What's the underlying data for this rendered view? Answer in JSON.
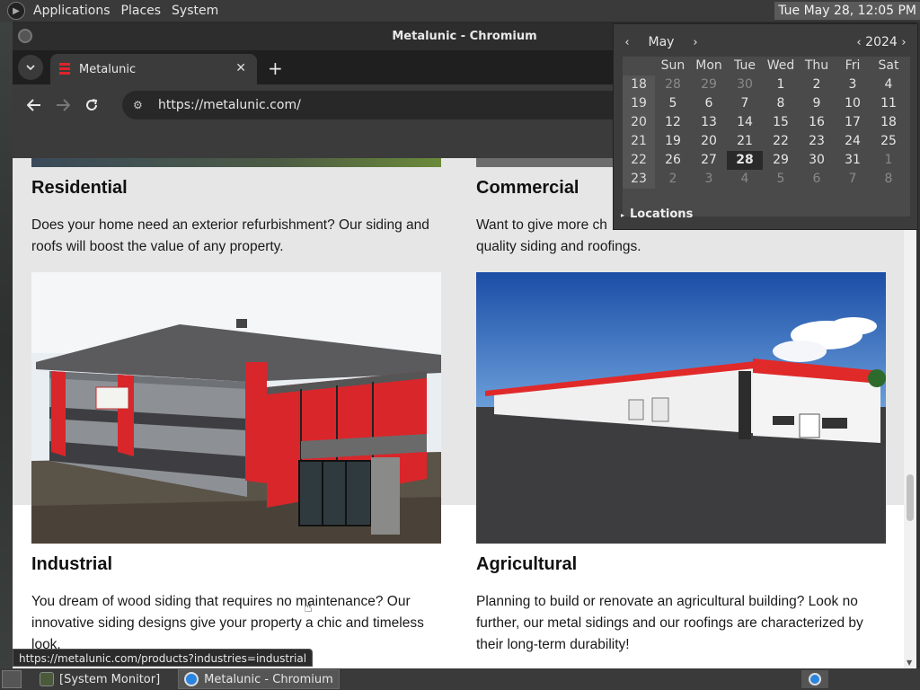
{
  "panel": {
    "menus": [
      "Applications",
      "Places",
      "System"
    ],
    "clock": "Tue May 28, 12:05 PM"
  },
  "window": {
    "title": "Metalunic - Chromium",
    "tab": {
      "title": "Metalunic"
    },
    "url": "https://metalunic.com/"
  },
  "page": {
    "cards": [
      {
        "heading": "Residential",
        "text": "Does your home need an exterior refurbishment? Our siding and roofs will boost the value of any property."
      },
      {
        "heading": "Commercial",
        "text": "Want to give more ch... quality siding and roofings."
      },
      {
        "heading": "Industrial",
        "text": "You dream of wood siding that requires no maintenance? Our innovative siding designs give your property a chic and timeless look."
      },
      {
        "heading": "Agricultural",
        "text": "Planning to build or renovate an agricultural building? Look no further, our metal sidings and our roofings are characterized by their long-term durability!"
      }
    ],
    "commercial_visible_line1": "Want to give more ch",
    "commercial_visible_line2": "quality siding and roofings."
  },
  "status_url": "https://metalunic.com/products?industries=industrial",
  "calendar": {
    "month": "May",
    "year": "2024",
    "weekdays": [
      "Sun",
      "Mon",
      "Tue",
      "Wed",
      "Thu",
      "Fri",
      "Sat"
    ],
    "weeks": [
      {
        "num": "18",
        "days": [
          "28",
          "29",
          "30",
          "1",
          "2",
          "3",
          "4"
        ],
        "other": [
          true,
          true,
          true,
          false,
          false,
          false,
          false
        ]
      },
      {
        "num": "19",
        "days": [
          "5",
          "6",
          "7",
          "8",
          "9",
          "10",
          "11"
        ],
        "other": [
          false,
          false,
          false,
          false,
          false,
          false,
          false
        ]
      },
      {
        "num": "20",
        "days": [
          "12",
          "13",
          "14",
          "15",
          "16",
          "17",
          "18"
        ],
        "other": [
          false,
          false,
          false,
          false,
          false,
          false,
          false
        ]
      },
      {
        "num": "21",
        "days": [
          "19",
          "20",
          "21",
          "22",
          "23",
          "24",
          "25"
        ],
        "other": [
          false,
          false,
          false,
          false,
          false,
          false,
          false
        ]
      },
      {
        "num": "22",
        "days": [
          "26",
          "27",
          "28",
          "29",
          "30",
          "31",
          "1"
        ],
        "other": [
          false,
          false,
          false,
          false,
          false,
          false,
          true
        ]
      },
      {
        "num": "23",
        "days": [
          "2",
          "3",
          "4",
          "5",
          "6",
          "7",
          "8"
        ],
        "other": [
          true,
          true,
          true,
          true,
          true,
          true,
          true
        ]
      }
    ],
    "today": "28",
    "locations_label": "Locations"
  },
  "taskbar": {
    "tasks": [
      "[System Monitor]",
      "Metalunic - Chromium"
    ]
  },
  "colors": {
    "accent_red": "#e0232a",
    "panel": "#3a3a3a",
    "chrome_dark": "#3b3b3b"
  }
}
